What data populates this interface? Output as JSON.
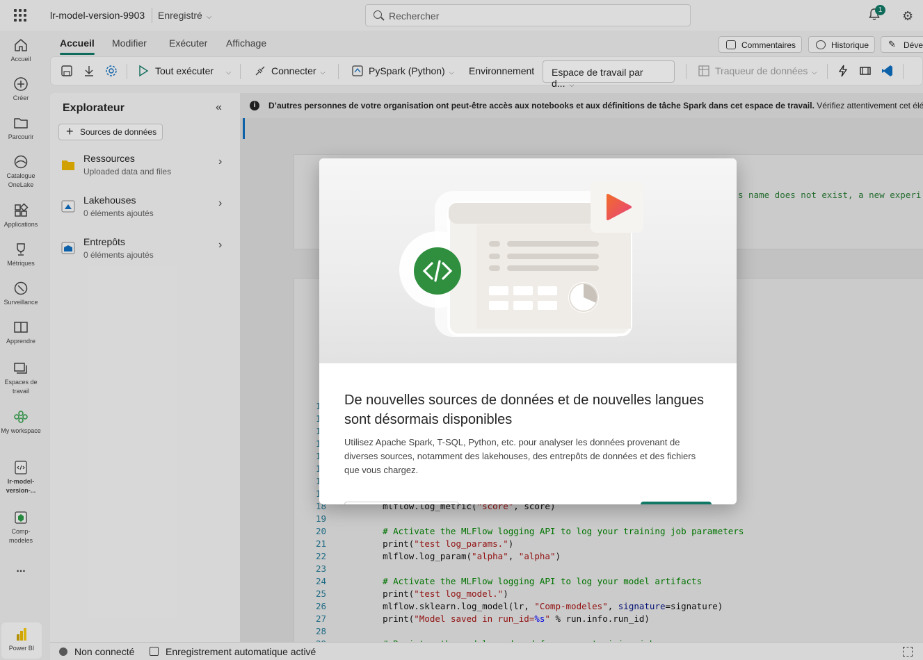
{
  "header": {
    "doc_name": "lr-model-version-9903",
    "doc_state": "Enregistré",
    "search_placeholder": "Rechercher",
    "notif_count": "1"
  },
  "rail": [
    {
      "label": "Accueil",
      "icon": "home-icon"
    },
    {
      "label": "Créer",
      "icon": "plus-circle-icon"
    },
    {
      "label": "Parcourir",
      "icon": "folder-icon"
    },
    {
      "label": "Catalogue OneLake",
      "icon": "onelake-icon"
    },
    {
      "label": "Applications",
      "icon": "apps-icon"
    },
    {
      "label": "Métriques",
      "icon": "trophy-icon"
    },
    {
      "label": "Surveillance",
      "icon": "monitor-icon"
    },
    {
      "label": "Apprendre",
      "icon": "book-icon"
    },
    {
      "label": "Espaces de travail",
      "icon": "workspaces-icon"
    },
    {
      "label": "My workspace",
      "icon": "people-icon"
    },
    {
      "label": "lr-model-version-...",
      "icon": "notebook-icon"
    },
    {
      "label": "Comp-modeles",
      "icon": "model-icon"
    },
    {
      "label": "...",
      "icon": "more-icon"
    },
    {
      "label": "Power BI",
      "icon": "powerbi-icon"
    }
  ],
  "tabs": {
    "items": [
      "Accueil",
      "Modifier",
      "Exécuter",
      "Affichage"
    ],
    "comments": "Commentaires",
    "history": "Historique",
    "dev": "Dével"
  },
  "ribbon": {
    "run_all": "Tout exécuter",
    "connect": "Connecter",
    "language": "PySpark (Python)",
    "environment": "Environnement",
    "workspace": "Espace de travail par d...",
    "tracker": "Traqueur de données"
  },
  "explorer": {
    "title": "Explorateur",
    "add_source": "Sources de données",
    "items": [
      {
        "title": "Ressources",
        "subtitle": "Uploaded data and files"
      },
      {
        "title": "Lakehouses",
        "subtitle": "0 éléments ajoutés"
      },
      {
        "title": "Entrepôts",
        "subtitle": "0 éléments ajoutés"
      }
    ]
  },
  "banner": {
    "bold": "D’autres personnes de votre organisation ont peut-être accès aux notebooks et aux définitions de tâche Spark dans cet espace de travail.",
    "rest": " Vérifiez attentivement cet éléme"
  },
  "code": {
    "partial_line_1": "s name does not exist, a new experi",
    "lines": [
      {
        "n": "18",
        "t": "    mlflow.log_metric(\"score\", score)"
      },
      {
        "n": "19",
        "t": ""
      },
      {
        "n": "20",
        "t": "    # Activate the MLFlow logging API to log your training job parameters"
      },
      {
        "n": "21",
        "t": "    print(\"test log_params.\")"
      },
      {
        "n": "22",
        "t": "    mlflow.log_param(\"alpha\", \"alpha\")"
      },
      {
        "n": "23",
        "t": ""
      },
      {
        "n": "24",
        "t": "    # Activate the MLFlow logging API to log your model artifacts"
      },
      {
        "n": "25",
        "t": "    print(\"test log_model.\")"
      },
      {
        "n": "26",
        "t": "    mlflow.sklearn.log_model(lr, \"Comp-modeles\", signature=signature)"
      },
      {
        "n": "27",
        "t": "    print(\"Model saved in run_id=%s\" % run.info.run_id)"
      },
      {
        "n": "28",
        "t": ""
      },
      {
        "n": "29",
        "t": "    # Register the model produced from your training job"
      }
    ],
    "hidden_numbers": [
      "10",
      "11",
      "12",
      "13",
      "14",
      "15",
      "16",
      "17"
    ]
  },
  "status": {
    "connection": "Non connecté",
    "autosave": "Enregistrement automatique activé"
  },
  "dialog": {
    "title": "De nouvelles sources de données et de nouvelles langues sont désormais disponibles",
    "body": "Utilisez Apache Spark, T-SQL, Python, etc. pour analyser les données provenant de diverses sources, notamment des lakehouses, des entrepôts de données et des fichiers que vous chargez."
  },
  "colors": {
    "accent": "#117865",
    "code_green": "#2a9a45",
    "play_gradient": "#e8457a"
  }
}
